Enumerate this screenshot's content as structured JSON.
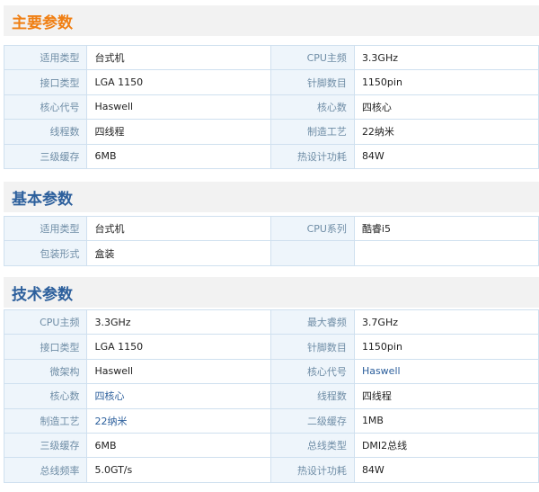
{
  "sections": [
    {
      "title": "主要参数",
      "rows": [
        [
          {
            "label": "适用类型",
            "value": "台式机"
          },
          {
            "label": "CPU主频",
            "value": "3.3GHz"
          }
        ],
        [
          {
            "label": "接口类型",
            "value": "LGA 1150"
          },
          {
            "label": "针脚数目",
            "value": "1150pin"
          }
        ],
        [
          {
            "label": "核心代号",
            "value": "Haswell"
          },
          {
            "label": "核心数",
            "value": "四核心"
          }
        ],
        [
          {
            "label": "线程数",
            "value": "四线程"
          },
          {
            "label": "制造工艺",
            "value": "22纳米"
          }
        ],
        [
          {
            "label": "三级缓存",
            "value": "6MB"
          },
          {
            "label": "热设计功耗",
            "value": "84W"
          }
        ]
      ]
    },
    {
      "title": "基本参数",
      "rows": [
        [
          {
            "label": "适用类型",
            "value": "台式机"
          },
          {
            "label": "CPU系列",
            "value": "酷睿i5"
          }
        ],
        [
          {
            "label": "包装形式",
            "value": "盒装"
          },
          {
            "label": "",
            "value": ""
          }
        ]
      ]
    },
    {
      "title": "技术参数",
      "rows": [
        [
          {
            "label": "CPU主频",
            "value": "3.3GHz"
          },
          {
            "label": "最大睿频",
            "value": "3.7GHz"
          }
        ],
        [
          {
            "label": "接口类型",
            "value": "LGA 1150"
          },
          {
            "label": "针脚数目",
            "value": "1150pin"
          }
        ],
        [
          {
            "label": "微架构",
            "value": "Haswell"
          },
          {
            "label": "核心代号",
            "value": "Haswell"
          }
        ],
        [
          {
            "label": "核心数",
            "value": "四核心"
          },
          {
            "label": "线程数",
            "value": "四线程"
          }
        ],
        [
          {
            "label": "制造工艺",
            "value": "22纳米"
          },
          {
            "label": "二级缓存",
            "value": "1MB"
          }
        ],
        [
          {
            "label": "三级缓存",
            "value": "6MB"
          },
          {
            "label": "总线类型",
            "value": "DMI2总线"
          }
        ],
        [
          {
            "label": "总线频率",
            "value": "5.0GT/s"
          },
          {
            "label": "热设计功耗",
            "value": "84W"
          }
        ]
      ]
    }
  ],
  "colors": {
    "primary_header": "#f07f13",
    "secondary_header": "#2c5f9c",
    "label_background": "#eef5fb",
    "border": "#cfe0ef",
    "link_value": "#2c5f9c"
  }
}
